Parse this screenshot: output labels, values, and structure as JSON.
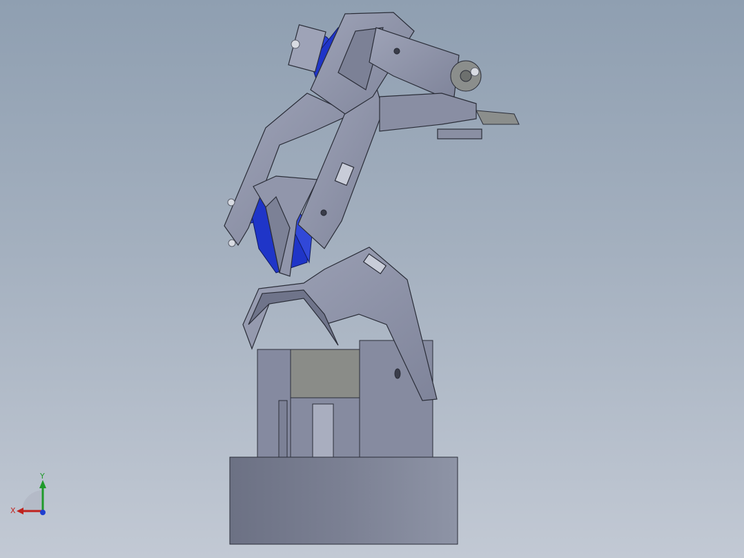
{
  "viewport": {
    "background_top": "#8f9fb1",
    "background_bottom": "#c2c9d4"
  },
  "model": {
    "description_name": "robot-arm-assembly",
    "part_color_metal": "#8a8fa6",
    "part_color_servo": "#1f35c8",
    "part_color_base": "#747a8c"
  },
  "triad": {
    "x_label": "X",
    "y_label": "Y",
    "x_color": "#c0231e",
    "y_color": "#1f9a2a",
    "z_color": "#1f3fd0"
  }
}
